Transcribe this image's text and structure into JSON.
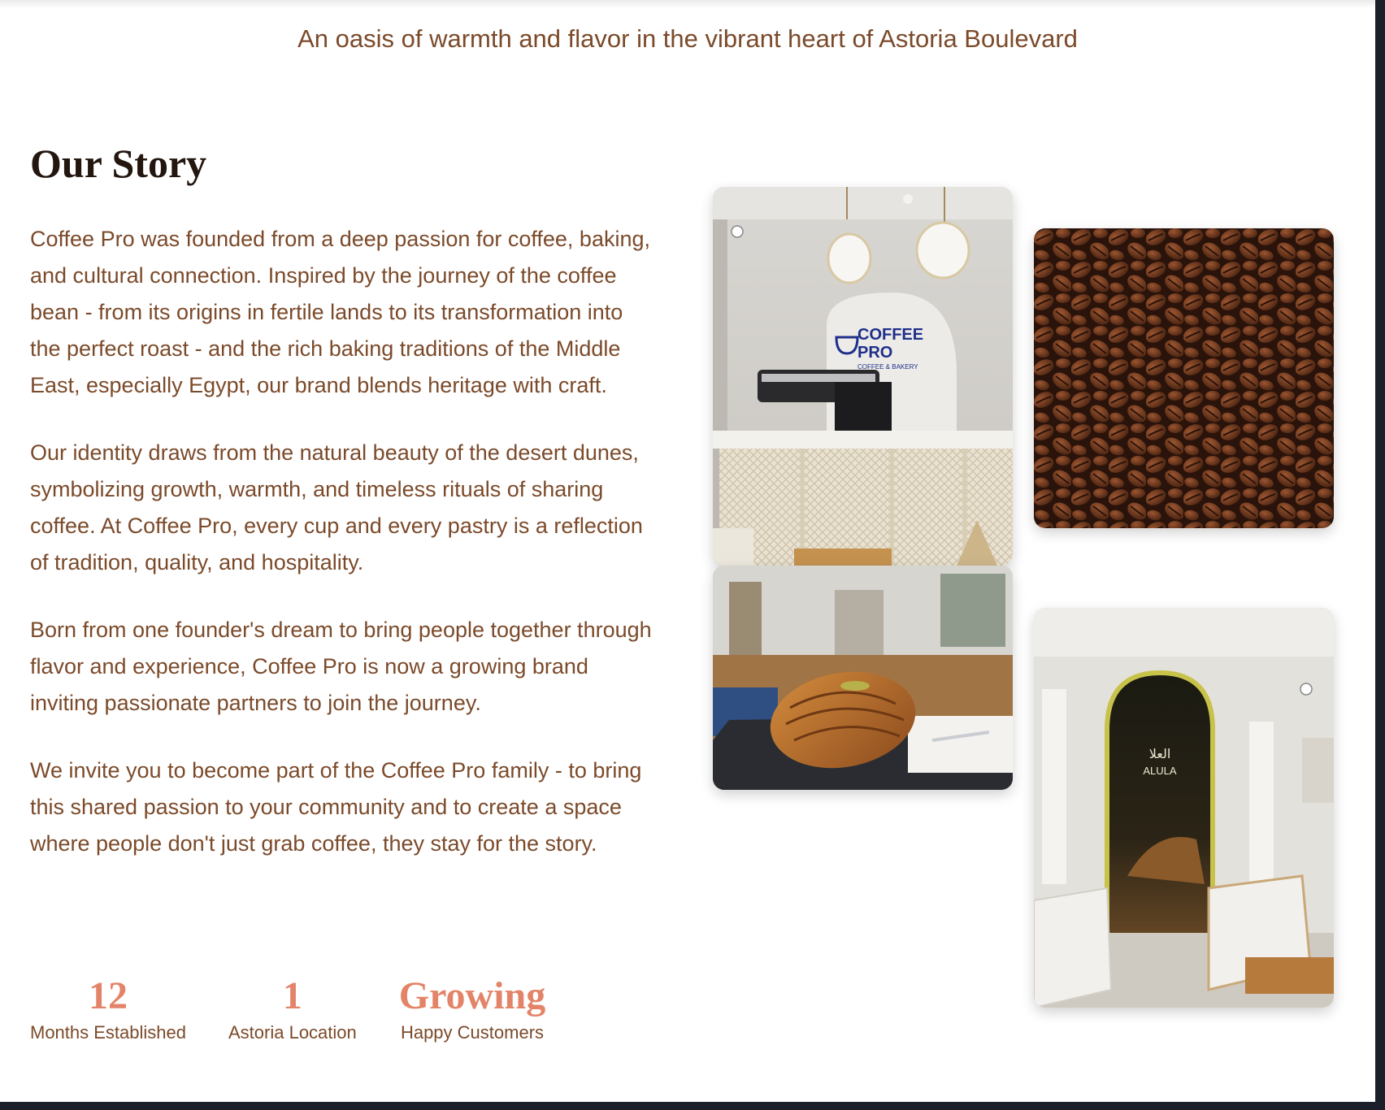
{
  "tagline": "An oasis of warmth and flavor in the vibrant heart of Astoria Boulevard",
  "story": {
    "title": "Our Story",
    "paragraphs": [
      "Coffee Pro was founded from a deep passion for coffee, baking, and cultural connection. Inspired by the journey of the coffee bean - from its origins in fertile lands to its transformation into the perfect roast - and the rich baking traditions of the Middle East, especially Egypt, our brand blends heritage with craft.",
      "Our identity draws from the natural beauty of the desert dunes, symbolizing growth, warmth, and timeless rituals of sharing coffee. At Coffee Pro, every cup and every pastry is a reflection of tradition, quality, and hospitality.",
      "Born from one founder's dream to bring people together through flavor and experience, Coffee Pro is now a growing brand inviting passionate partners to join the journey.",
      "We invite you to become part of the Coffee Pro family - to bring this shared passion to your community and to create a space where people don't just grab coffee, they stay for the story."
    ]
  },
  "stats": [
    {
      "value": "12",
      "label": "Months Established"
    },
    {
      "value": "1",
      "label": "Astoria Location"
    },
    {
      "value": "Growing",
      "label": "Happy Customers"
    }
  ],
  "photos": {
    "interior_sign": {
      "line1": "COFFEE",
      "line2": "PRO",
      "line3": "COFFEE & BAKERY"
    },
    "alula_sign": {
      "arabic": "العلا",
      "latin": "ALULA"
    }
  },
  "colors": {
    "text_brown": "#7b4a2a",
    "heading": "#23160e",
    "accent": "#e38468"
  }
}
